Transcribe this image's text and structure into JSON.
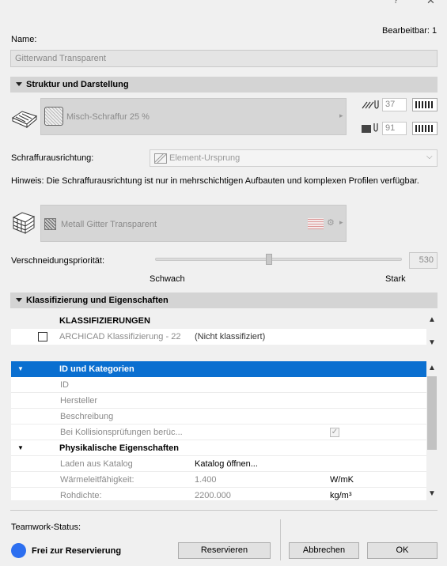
{
  "window": {
    "help_glyph": "?",
    "close_glyph": "✕"
  },
  "header": {
    "name_label": "Name:",
    "editable_label": "Bearbeitbar: 1",
    "name_value": "Gitterwand Transparent"
  },
  "structure": {
    "section_title": "Struktur und Darstellung",
    "fill_name": "Misch-Schraffur 25 %",
    "pen_top_value": "37",
    "pen_bottom_value": "91",
    "orientation_label": "Schraffurausrichtung:",
    "orientation_value": "Element-Ursprung",
    "hint_text": "Hinweis: Die Schraffurausrichtung ist nur in mehrschichtigen Aufbauten und komplexen Profilen verfügbar.",
    "material_name": "Metall Gitter Transparent",
    "priority_label": "Verschneidungspriorität:",
    "priority_value": "530",
    "priority_level": 0.46,
    "weak_label": "Schwach",
    "strong_label": "Stark"
  },
  "classification": {
    "section_title": "Klassifizierung und Eigenschaften",
    "header": "KLASSIFIZIERUNGEN",
    "row_name": "ARCHICAD Klassifizierung - 22",
    "row_value": "(Nicht klassifiziert)"
  },
  "properties": {
    "group1_title": "ID und Kategorien",
    "group1_rows": [
      {
        "name": "ID"
      },
      {
        "name": "Hersteller"
      },
      {
        "name": "Beschreibung"
      },
      {
        "name": "Bei Kollisionsprüfungen berüc..."
      }
    ],
    "group2_title": "Physikalische Eigenschaften",
    "group2_rows": [
      {
        "name": "Laden aus Katalog",
        "value": "Katalog öffnen...",
        "unit": ""
      },
      {
        "name": "Wärmeleitfähigkeit:",
        "value": "1.400",
        "unit": "W/mK"
      },
      {
        "name": "Rohdichte:",
        "value": "2200.000",
        "unit": "kg/m³"
      }
    ]
  },
  "footer": {
    "teamwork_label": "Teamwork-Status:",
    "status_text": "Frei zur Reservierung",
    "status_color": "#2d6ff0",
    "reserve_button": "Reservieren",
    "cancel_button": "Abbrechen",
    "ok_button": "OK"
  }
}
